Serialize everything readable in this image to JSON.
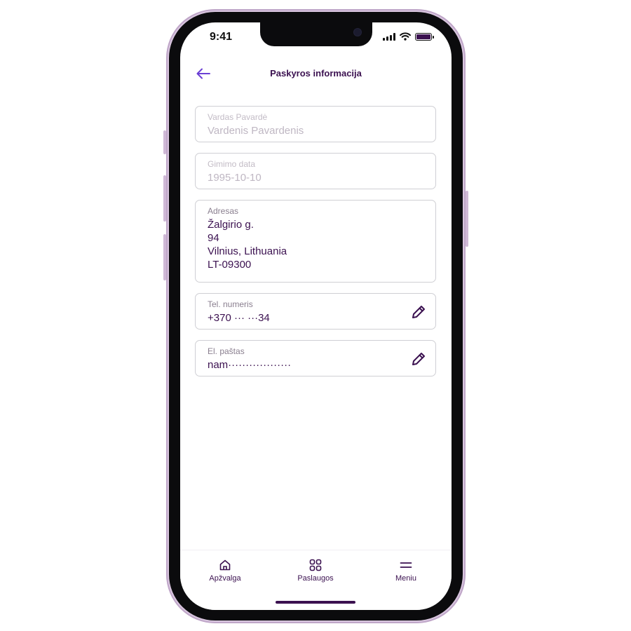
{
  "status_bar": {
    "time": "9:41"
  },
  "header": {
    "title": "Paskyros informacija"
  },
  "fields": {
    "name": {
      "label": "Vardas Pavardė",
      "value": "Vardenis Pavardenis"
    },
    "birth_date": {
      "label": "Gimimo data",
      "value": "1995-10-10"
    },
    "address": {
      "label": "Adresas",
      "lines": [
        "Žalgirio g.",
        "94",
        "Vilnius, Lithuania",
        "LT-09300"
      ]
    },
    "phone": {
      "label": "Tel. numeris",
      "value": "+370 ··· ···34"
    },
    "email": {
      "label": "El. paštas",
      "value": "nam··················"
    }
  },
  "tabbar": {
    "tabs": [
      {
        "label": "Apžvalga",
        "icon": "home-icon"
      },
      {
        "label": "Paslaugos",
        "icon": "grid-icon"
      },
      {
        "label": "Meniu",
        "icon": "menu-icon"
      }
    ]
  },
  "colors": {
    "primary": "#3b1150",
    "accent": "#6b3fd4",
    "frame": "#d9c6df",
    "border": "#cfcfd4"
  }
}
